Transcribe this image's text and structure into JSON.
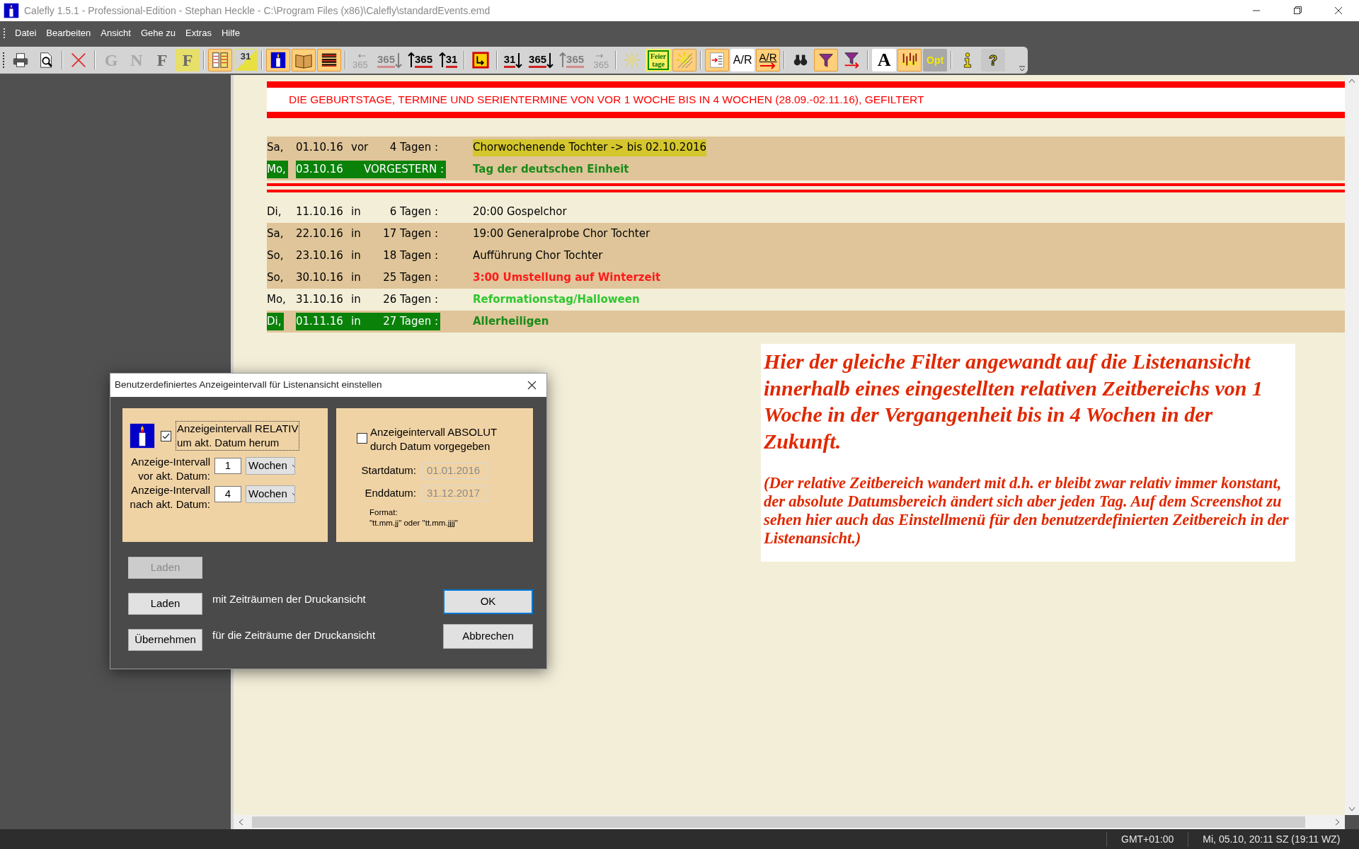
{
  "window": {
    "title": "Calefly 1.5.1 - Professional-Edition - Stephan Heckle - C:\\Program Files (x86)\\Calefly\\standardEvents.emd"
  },
  "menu": [
    "Datei",
    "Bearbeiten",
    "Ansicht",
    "Gehe zu",
    "Extras",
    "Hilfe"
  ],
  "toolbar": [
    [
      {
        "kind": "printer",
        "pressed": false,
        "disabled": false
      },
      {
        "kind": "preview",
        "pressed": false,
        "disabled": false
      }
    ],
    [
      {
        "kind": "delete",
        "pressed": false,
        "disabled": false
      }
    ],
    [
      {
        "kind": "letter",
        "label": "G",
        "marked": false,
        "pressed": false,
        "disabled": true
      },
      {
        "kind": "letter",
        "label": "N",
        "marked": false,
        "pressed": false,
        "disabled": true
      },
      {
        "kind": "letter",
        "label": "F",
        "marked": false,
        "pressed": false,
        "disabled": false
      },
      {
        "kind": "letter",
        "label": "F",
        "marked": true,
        "pressed": false,
        "disabled": false
      }
    ],
    [
      {
        "kind": "columns",
        "pressed": true,
        "disabled": false
      },
      {
        "kind": "calendar-diag",
        "label": "31",
        "pressed": false,
        "disabled": false
      }
    ],
    [
      {
        "kind": "candle",
        "pressed": true,
        "disabled": false
      },
      {
        "kind": "book",
        "pressed": true,
        "disabled": false
      },
      {
        "kind": "lines",
        "pressed": true,
        "disabled": false
      }
    ],
    [
      {
        "kind": "number-left",
        "label": "365",
        "pressed": false,
        "disabled": true
      },
      {
        "kind": "number-down",
        "label": "365",
        "pressed": false,
        "disabled": true
      },
      {
        "kind": "number-up",
        "label": "365",
        "pressed": false,
        "disabled": false
      },
      {
        "kind": "number-up",
        "label": "31",
        "pressed": false,
        "disabled": false
      }
    ],
    [
      {
        "kind": "box",
        "pressed": false,
        "disabled": false
      }
    ],
    [
      {
        "kind": "number-down",
        "label": "31",
        "pressed": false,
        "disabled": false
      },
      {
        "kind": "number-down",
        "label": "365",
        "pressed": false,
        "disabled": false
      },
      {
        "kind": "number-up",
        "label": "365",
        "pressed": false,
        "disabled": true
      },
      {
        "kind": "number-right",
        "label": "365",
        "pressed": false,
        "disabled": true
      }
    ],
    [
      {
        "kind": "sun",
        "pressed": false,
        "disabled": true
      },
      {
        "kind": "holidays",
        "label": "Feier tage",
        "pressed": false,
        "disabled": false
      },
      {
        "kind": "sun-hatched",
        "pressed": true,
        "disabled": false
      }
    ],
    [
      {
        "kind": "list",
        "pressed": true,
        "disabled": false
      },
      {
        "kind": "text-ar",
        "label": "A/R",
        "pressed": false,
        "disabled": false
      },
      {
        "kind": "text-ar-arrow",
        "label": "A/R",
        "pressed": true,
        "disabled": false
      }
    ],
    [
      {
        "kind": "binoculars",
        "pressed": false,
        "disabled": false
      },
      {
        "kind": "funnel",
        "pressed": true,
        "disabled": false
      },
      {
        "kind": "funnel-arrow",
        "pressed": false,
        "disabled": false
      }
    ],
    [
      {
        "kind": "font",
        "label": "A",
        "pressed": false,
        "disabled": false
      },
      {
        "kind": "chart",
        "pressed": true,
        "disabled": false
      },
      {
        "kind": "opt",
        "label": "Opt",
        "pressed": false,
        "disabled": false
      }
    ],
    [
      {
        "kind": "info",
        "pressed": false,
        "disabled": false
      },
      {
        "kind": "help",
        "label": "?",
        "pressed": false,
        "disabled": false
      }
    ]
  ],
  "list": {
    "header": "DIE GEBURTSTAGE, TERMINE UND SERIENTERMINE VON VOR 1 WOCHE BIS IN 4 WOCHEN (28.09.-02.11.16), GEFILTERT",
    "sections": [
      {
        "rows": [
          {
            "day": "Sa,",
            "date": "01.10.16",
            "prep": "vor",
            "span": "4 Tagen :",
            "event": "Chorwochenende Tochter -> bis 02.10.2016",
            "kind": "marked",
            "shaded": true,
            "holiday": false
          },
          {
            "day": "Mo,",
            "date": "03.10.16",
            "span": "VORGESTERN :",
            "event": "Tag der deutschen Einheit",
            "kind": "holiday",
            "shaded": true,
            "holiday": true
          }
        ]
      },
      {
        "rows": [
          {
            "day": "Di,",
            "date": "11.10.16",
            "prep": "in",
            "span": "6 Tagen :",
            "event": "20:00 Gospelchor",
            "kind": "plain",
            "shaded": false,
            "holiday": false
          },
          {
            "day": "Sa,",
            "date": "22.10.16",
            "prep": "in",
            "span": "17 Tagen :",
            "event": "19:00 Generalprobe Chor Tochter",
            "kind": "plain",
            "shaded": true,
            "holiday": false
          },
          {
            "day": "So,",
            "date": "23.10.16",
            "prep": "in",
            "span": "18 Tagen :",
            "event": "Aufführung Chor Tochter",
            "kind": "plain",
            "shaded": true,
            "holiday": false
          },
          {
            "day": "So,",
            "date": "30.10.16",
            "prep": "in",
            "span": "25 Tagen :",
            "event": "3:00 Umstellung auf Winterzeit",
            "kind": "alert",
            "shaded": true,
            "holiday": false
          },
          {
            "day": "Mo,",
            "date": "31.10.16",
            "prep": "in",
            "span": "26 Tagen :",
            "event": "Reformationstag/Halloween",
            "kind": "special",
            "shaded": false,
            "holiday": false
          },
          {
            "day": "Di,",
            "date": "01.11.16",
            "prep": "in",
            "span": "27 Tagen :",
            "event": "Allerheiligen",
            "kind": "holiday",
            "shaded": true,
            "holiday": true
          }
        ]
      }
    ]
  },
  "note": {
    "headline": "Hier der gleiche Filter angewandt auf die Listenansicht innerhalb eines eingestellten relativen Zeitbereichs von 1 Woche in der Vergangenheit bis in 4 Wochen in der Zukunft.",
    "remark": "(Der relative Zeitbereich wandert mit d.h. er bleibt zwar relativ immer konstant, der absolute Datumsbereich ändert sich aber jeden Tag. Auf dem Screenshot zu sehen hier auch das Einstellmenü für den benutzerdefinierten Zeitbereich in der Listenansicht.)"
  },
  "dialog": {
    "title": "Benutzerdefiniertes Anzeigeintervall für Listenansicht einstellen",
    "relative": {
      "checked": true,
      "focused": true,
      "label": [
        "Anzeigeintervall RELATIV",
        "um akt. Datum herum"
      ],
      "intervals": [
        {
          "label": [
            "Anzeige-Intervall",
            "vor akt. Datum:"
          ],
          "value": "1",
          "unit": "Wochen"
        },
        {
          "label": [
            "Anzeige-Intervall",
            "nach akt. Datum:"
          ],
          "value": "4",
          "unit": "Wochen"
        }
      ]
    },
    "absolute": {
      "checked": false,
      "focused": false,
      "label": [
        "Anzeigeintervall ABSOLUT",
        "durch Datum vorgegeben"
      ],
      "fields": [
        {
          "label": "Startdatum:",
          "value": "01.01.2016",
          "disabled": true
        },
        {
          "label": "Enddatum:",
          "value": "31.12.2017",
          "disabled": true
        }
      ],
      "format": [
        "Format:",
        "\"tt.mm.jj\" oder \"tt.mm.jjjj\""
      ]
    },
    "actions": [
      {
        "button": "Laden",
        "disabled": true
      },
      {
        "button": "Laden",
        "text": "mit Zeiträumen der Druckansicht",
        "disabled": false
      },
      {
        "button": "Übernehmen",
        "text": "für die Zeiträume der Druckansicht",
        "disabled": false
      }
    ],
    "buttons": [
      {
        "label": "OK",
        "default": true
      },
      {
        "label": "Abbrechen",
        "default": false
      }
    ]
  },
  "status_bar": [
    "GMT+01:00",
    "Mi, 05.10, 20:11 SZ (19:11 WZ)"
  ]
}
